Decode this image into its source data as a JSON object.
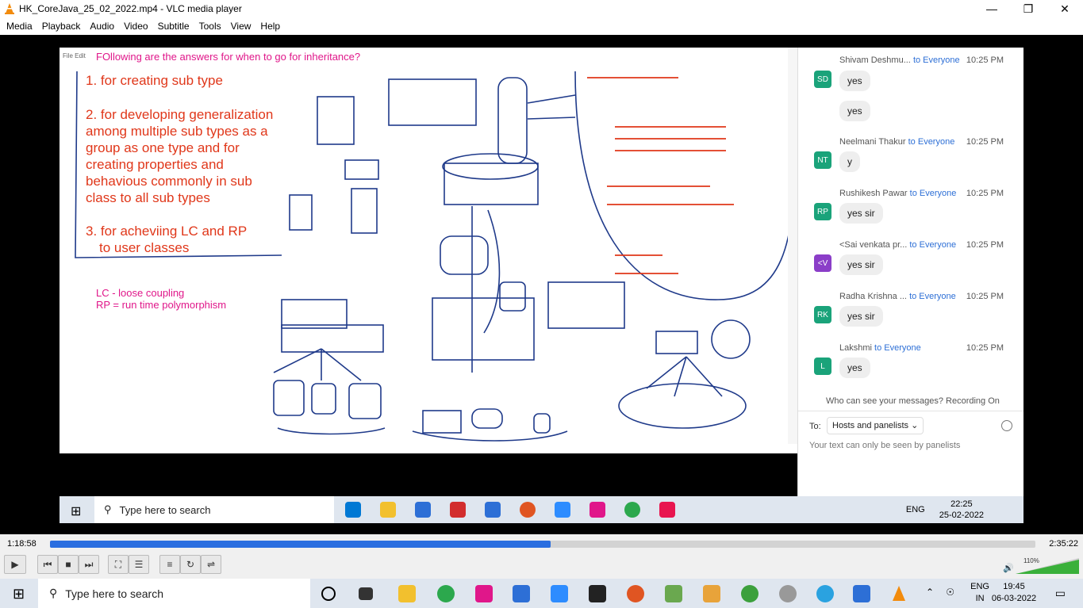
{
  "window": {
    "title": "HK_CoreJava_25_02_2022.mp4 - VLC media player",
    "minimize": "—",
    "maximize": "❐",
    "close": "✕"
  },
  "menu": [
    "Media",
    "Playback",
    "Audio",
    "Video",
    "Subtitle",
    "Tools",
    "View",
    "Help"
  ],
  "board": {
    "toolbar_text": "File  Edit",
    "pink_note": "FOllowing are the answers for when to go for inheritance?",
    "points": [
      "1. for creating sub type",
      "2. for developing generalization",
      "among multiple sub types as a",
      "group as one type and for",
      "creating properties and",
      "behavious commonly in sub",
      "class to all sub types",
      "3. for acheviing LC and RP",
      "to user classes"
    ],
    "lc_note": "LC - loose coupling",
    "rp_note": "RP = run time polymorphism"
  },
  "chat": {
    "messages": [
      {
        "sender": "Shivam Deshmu...",
        "to": "to Everyone",
        "time": "10:25 PM",
        "initials": "SD",
        "color": "#1aa37a",
        "texts": [
          "yes",
          "yes"
        ]
      },
      {
        "sender": "Neelmani Thakur",
        "to": "to Everyone",
        "time": "10:25 PM",
        "initials": "NT",
        "color": "#1aa37a",
        "texts": [
          "y"
        ]
      },
      {
        "sender": "Rushikesh Pawar",
        "to": "to Everyone",
        "time": "10:25 PM",
        "initials": "RP",
        "color": "#1aa37a",
        "texts": [
          "yes sir"
        ]
      },
      {
        "sender": "<Sai venkata pr...",
        "to": "to Everyone",
        "time": "10:25 PM",
        "initials": "<V",
        "color": "#8b3ec8",
        "texts": [
          "yes sir"
        ]
      },
      {
        "sender": "Radha Krishna ...",
        "to": "to Everyone",
        "time": "10:25 PM",
        "initials": "RK",
        "color": "#1aa37a",
        "texts": [
          "yes sir"
        ]
      },
      {
        "sender": "Lakshmi",
        "to": "to Everyone",
        "time": "10:25 PM",
        "initials": "L",
        "color": "#1aa37a",
        "texts": [
          "yes"
        ]
      }
    ],
    "who_can_see": "Who can see your messages? Recording On",
    "to_label": "To:",
    "to_value": "Hosts and panelists",
    "input_placeholder": "Your text can only be seen by panelists"
  },
  "inner_taskbar": {
    "search_placeholder": "Type here to search",
    "lang": "ENG",
    "time": "22:25",
    "date": "25-02-2022"
  },
  "player": {
    "elapsed": "1:18:58",
    "total": "2:35:22",
    "progress": 0.508,
    "volume_percent": "110%"
  },
  "taskbar": {
    "search_placeholder": "Type here to search",
    "lang_top": "ENG",
    "lang_bottom": "IN",
    "time": "19:45",
    "date": "06-03-2022"
  }
}
